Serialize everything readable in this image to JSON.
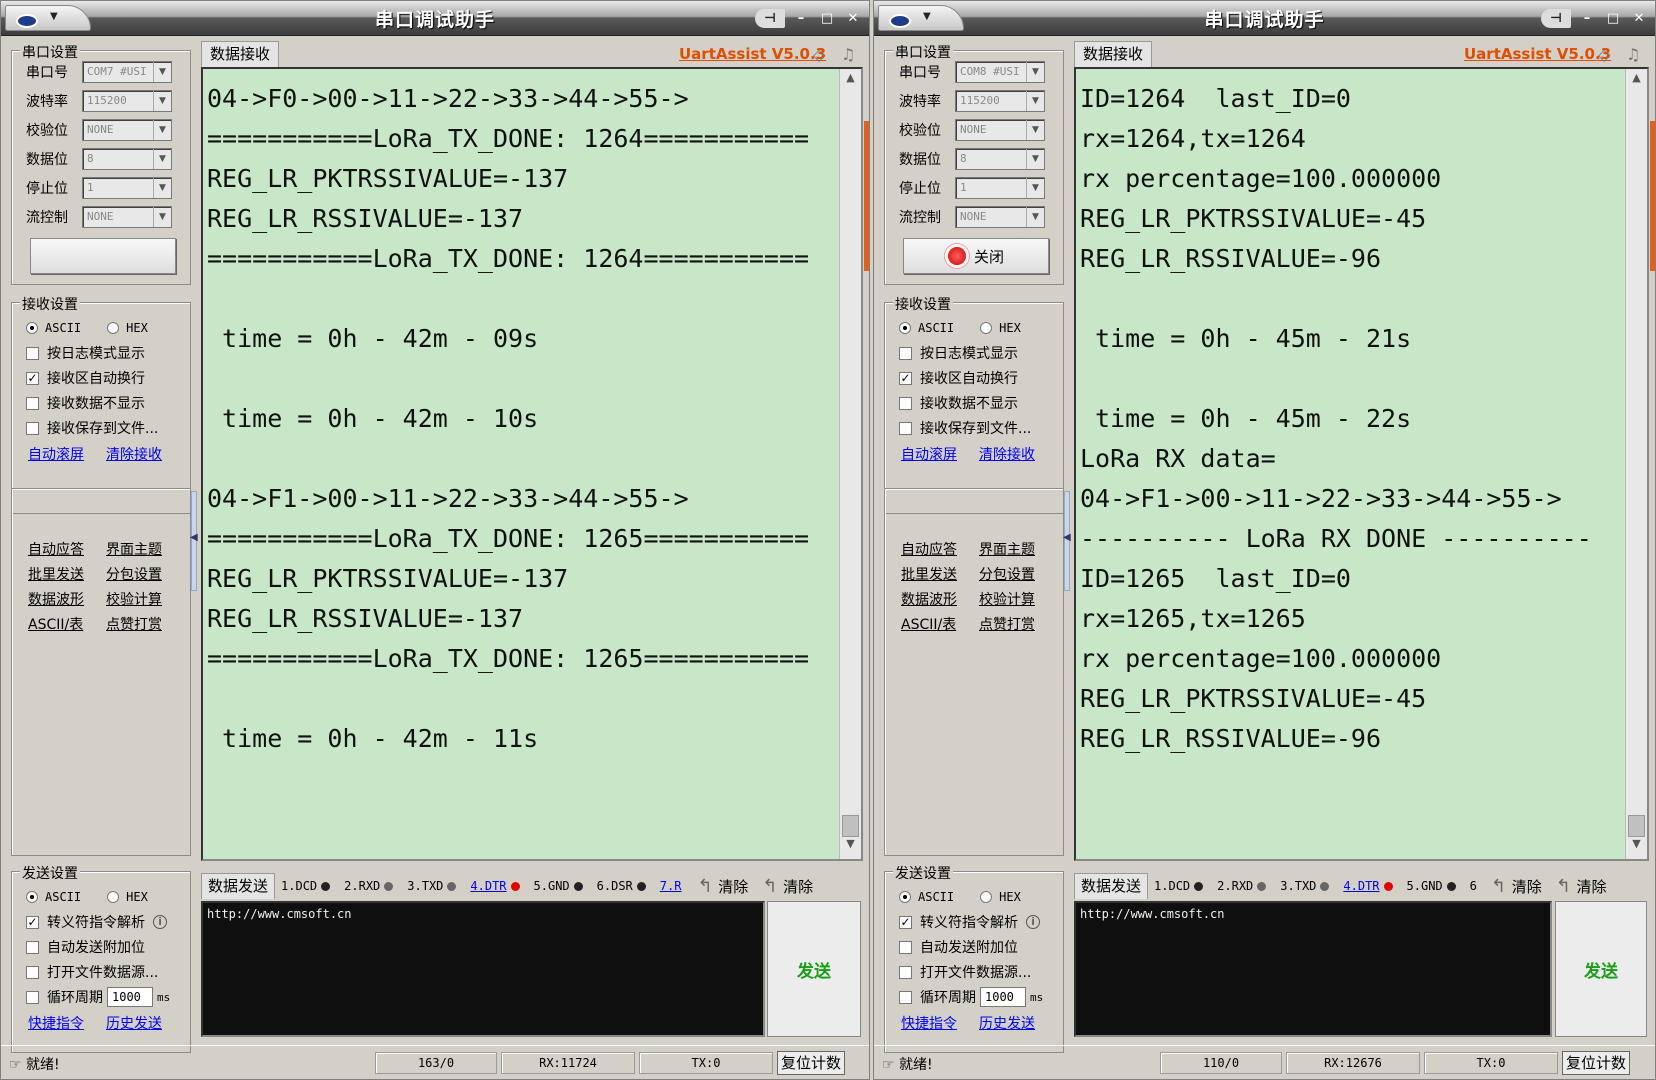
{
  "windows": [
    {
      "title": "串口调试助手",
      "port_settings": {
        "group_title": "串口设置",
        "fields": [
          {
            "label": "串口号",
            "value": "COM7 #USI"
          },
          {
            "label": "波特率",
            "value": "115200"
          },
          {
            "label": "校验位",
            "value": "NONE"
          },
          {
            "label": "数据位",
            "value": "8"
          },
          {
            "label": "停止位",
            "value": "1"
          },
          {
            "label": "流控制",
            "value": "NONE"
          }
        ],
        "open_button": ""
      },
      "recv_settings": {
        "group_title": "接收设置",
        "ascii": "ASCII",
        "hex": "HEX",
        "opt1": "按日志模式显示",
        "opt2": "接收区自动换行",
        "opt3": "接收数据不显示",
        "opt4": "接收保存到文件...",
        "link1": "自动滚屏",
        "link2": "清除接收"
      },
      "tools": [
        "自动应答",
        "界面主题",
        "批里发送",
        "分包设置",
        "数据波形",
        "校验计算",
        "ASCII/表",
        "点赞打赏"
      ],
      "recv_tab": "数据接收",
      "version": "UartAssist V5.0.3",
      "recv_text": "04->F0->00->11->22->33->44->55->\n===========LoRa_TX_DONE: 1264===========\nREG_LR_PKTRSSIVALUE=-137\nREG_LR_RSSIVALUE=-137\n===========LoRa_TX_DONE: 1264===========\n\n time = 0h - 42m - 09s\n\n time = 0h - 42m - 10s\n\n04->F1->00->11->22->33->44->55->\n===========LoRa_TX_DONE: 1265===========\nREG_LR_PKTRSSIVALUE=-137\nREG_LR_RSSIVALUE=-137\n===========LoRa_TX_DONE: 1265===========\n\n time = 0h - 42m - 11s",
      "send_settings": {
        "group_title": "发送设置",
        "ascii": "ASCII",
        "hex": "HEX",
        "opt1": "转义符指令解析",
        "opt2": "自动发送附加位",
        "opt3": "打开文件数据源...",
        "opt4": "循环周期",
        "period": "1000",
        "unit": "ms",
        "link1": "快捷指令",
        "link2": "历史发送"
      },
      "send_tab": "数据发送",
      "pins": [
        "1.DCD",
        "2.RXD",
        "3.TXD",
        "4.DTR",
        "5.GND",
        "6.DSR",
        "7.R"
      ],
      "clear1": "清除",
      "clear2": "清除",
      "send_text": "http://www.cmsoft.cn",
      "send_button": "发送",
      "status": {
        "ready": "就绪!",
        "count": "163/0",
        "rx": "RX:11724",
        "tx": "TX:0",
        "reset": "复位计数"
      }
    },
    {
      "title": "串口调试助手",
      "port_settings": {
        "group_title": "串口设置",
        "fields": [
          {
            "label": "串口号",
            "value": "COM8 #USI"
          },
          {
            "label": "波特率",
            "value": "115200"
          },
          {
            "label": "校验位",
            "value": "NONE"
          },
          {
            "label": "数据位",
            "value": "8"
          },
          {
            "label": "停止位",
            "value": "1"
          },
          {
            "label": "流控制",
            "value": "NONE"
          }
        ],
        "open_button": "关闭"
      },
      "recv_settings": {
        "group_title": "接收设置",
        "ascii": "ASCII",
        "hex": "HEX",
        "opt1": "按日志模式显示",
        "opt2": "接收区自动换行",
        "opt3": "接收数据不显示",
        "opt4": "接收保存到文件...",
        "link1": "自动滚屏",
        "link2": "清除接收"
      },
      "tools": [
        "自动应答",
        "界面主题",
        "批里发送",
        "分包设置",
        "数据波形",
        "校验计算",
        "ASCII/表",
        "点赞打赏"
      ],
      "recv_tab": "数据接收",
      "version": "UartAssist V5.0.3",
      "recv_text": "ID=1264  last_ID=0\nrx=1264,tx=1264\nrx percentage=100.000000\nREG_LR_PKTRSSIVALUE=-45\nREG_LR_RSSIVALUE=-96\n\n time = 0h - 45m - 21s\n\n time = 0h - 45m - 22s\nLoRa RX data=\n04->F1->00->11->22->33->44->55->\n---------- LoRa RX DONE ----------\nID=1265  last_ID=0\nrx=1265,tx=1265\nrx percentage=100.000000\nREG_LR_PKTRSSIVALUE=-45\nREG_LR_RSSIVALUE=-96",
      "send_settings": {
        "group_title": "发送设置",
        "ascii": "ASCII",
        "hex": "HEX",
        "opt1": "转义符指令解析",
        "opt2": "自动发送附加位",
        "opt3": "打开文件数据源...",
        "opt4": "循环周期",
        "period": "1000",
        "unit": "ms",
        "link1": "快捷指令",
        "link2": "历史发送"
      },
      "send_tab": "数据发送",
      "pins": [
        "1.DCD",
        "2.RXD",
        "3.TXD",
        "4.DTR",
        "5.GND",
        "6"
      ],
      "clear1": "清除",
      "clear2": "清除",
      "send_text": "http://www.cmsoft.cn",
      "send_button": "发送",
      "status": {
        "ready": "就绪!",
        "count": "110/0",
        "rx": "RX:12676",
        "tx": "TX:0",
        "reset": "复位计数"
      }
    }
  ],
  "colors": {
    "recv_bg": "#c8e6c8",
    "version": "#e04e00",
    "send_btn": "#1a9e1a"
  },
  "icons": [
    "app-logo-icon",
    "pin-icon",
    "minimize-icon",
    "maximize-icon",
    "close-icon",
    "diamond-icon",
    "bell-icon",
    "record-icon"
  ]
}
